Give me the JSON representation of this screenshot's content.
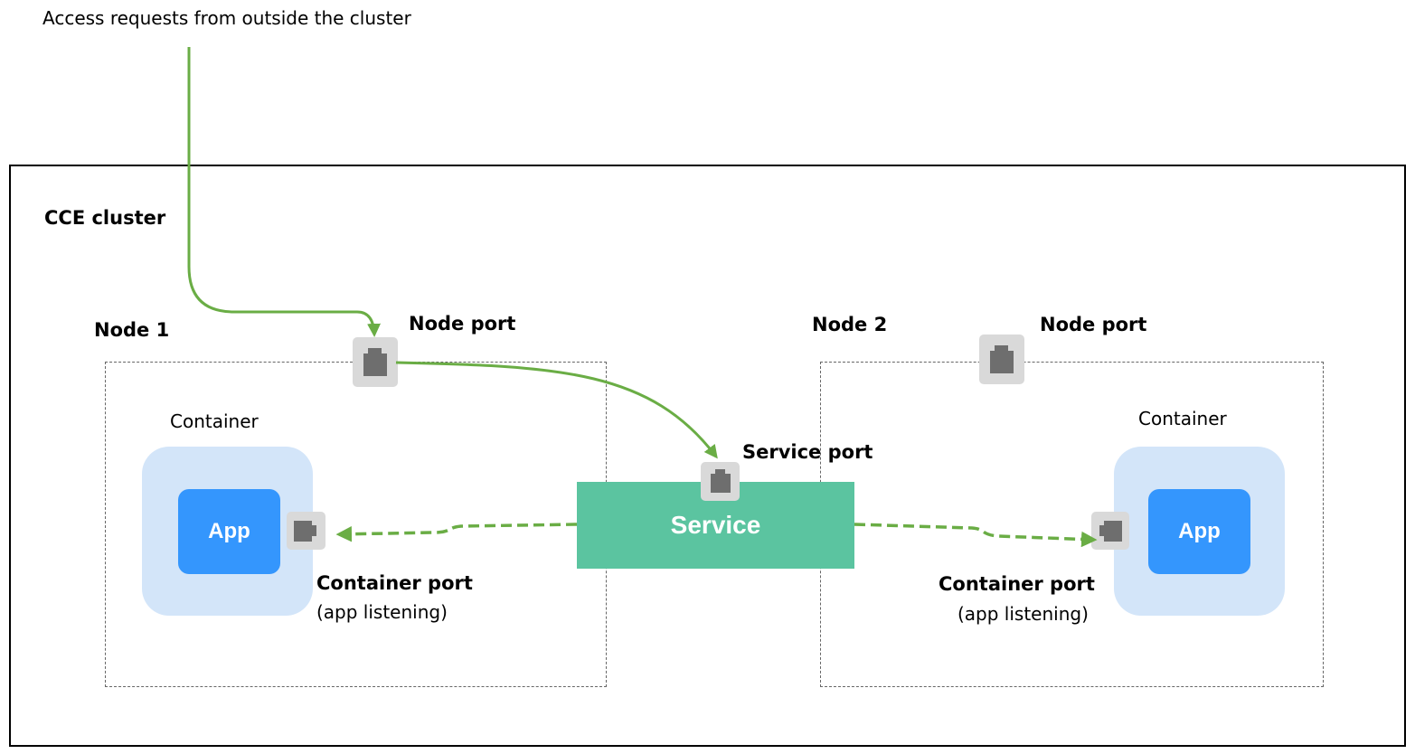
{
  "caption": "Access requests from outside the cluster",
  "cluster": {
    "label": "CCE cluster"
  },
  "node1": {
    "label": "Node 1",
    "node_port_label": "Node port",
    "container_label": "Container",
    "app_label": "App",
    "container_port_label": "Container port",
    "container_port_sublabel": "(app listening)"
  },
  "node2": {
    "label": "Node 2",
    "node_port_label": "Node port",
    "container_label": "Container",
    "app_label": "App",
    "container_port_label": "Container port",
    "container_port_sublabel": "(app listening)"
  },
  "service": {
    "label": "Service",
    "port_label": "Service port"
  },
  "colors": {
    "arrow": "#6aad45",
    "service": "#5bc4a0",
    "app": "#3496fd",
    "container": "#d3e5f9",
    "port_bg": "#d9d9d9",
    "port_icon": "#6e6e6e"
  }
}
